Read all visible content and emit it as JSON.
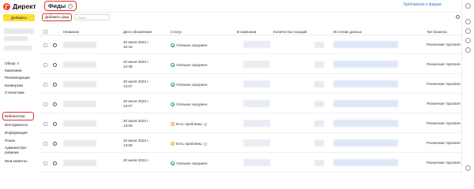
{
  "header": {
    "logo_text": "Директ",
    "page_title": "Фиды",
    "help_symbol": "?",
    "required_link": "Требования к фидам"
  },
  "sidebar": {
    "add_button": "Добавить",
    "items": [
      {
        "label": "Обзор",
        "badge": "8"
      },
      {
        "label": "Кампании",
        "badge": ""
      },
      {
        "label": "Рекомендации",
        "badge": ""
      },
      {
        "label": "Конверсии",
        "badge": ""
      },
      {
        "label": "Статистика",
        "badge": ""
      },
      {
        "label": "Библиотека",
        "badge": ""
      },
      {
        "label": "Инструменты",
        "badge": ""
      },
      {
        "label": "Информация",
        "badge": ""
      },
      {
        "label": "Поиск",
        "badge": ""
      },
      {
        "label": "Администри-",
        "badge": ""
      },
      {
        "label": "рование",
        "badge": ""
      },
      {
        "label": "Мои клиенты",
        "badge": ""
      }
    ]
  },
  "toolbar": {
    "add_feed_button": "Добавить фид",
    "search_placeholder": "Поиск"
  },
  "table": {
    "columns": [
      "Название",
      "Дата обновления",
      "Статус",
      "В кампании",
      "Количество позиций",
      "Источник данных",
      "Тип бизнеса"
    ],
    "rows": [
      {
        "date_line1": "20 июля 2023 г.",
        "date_line2": "16:15",
        "status": "Успешно загружен",
        "status_type": "ok",
        "business": "Розничная торговля"
      },
      {
        "date_line1": "20 июля 2023 г.",
        "date_line2": "14:38",
        "status": "Успешно загружен",
        "status_type": "ok",
        "business": "Розничная торговля"
      },
      {
        "date_line1": "20 июля 2023 г.",
        "date_line2": "13:07",
        "status": "Успешно загружен",
        "status_type": "ok",
        "business": "Розничная торговля"
      },
      {
        "date_line1": "20 июля 2023 г.",
        "date_line2": "13:07",
        "status": "Успешно загружен",
        "status_type": "ok",
        "business": "Розничная торговля"
      },
      {
        "date_line1": "20 июля 2023 г.",
        "date_line2": "13:06",
        "status": "Есть проблемы",
        "status_type": "warn",
        "business": "Розничная торговля"
      },
      {
        "date_line1": "20 июля 2023 г.",
        "date_line2": "13:06",
        "status": "Есть проблемы",
        "status_type": "warn",
        "business": "Розничная торговля"
      },
      {
        "date_line1": "20 июля 2023 г.",
        "date_line2": "",
        "status": "Успешно загружен",
        "status_type": "ok",
        "business": "Розничная торговля"
      }
    ]
  },
  "colors": {
    "brand_red": "#fc3f1d",
    "highlight_red": "#e0342a",
    "button_yellow": "#fddc36",
    "ok_green": "#30a14e",
    "warn_orange": "#f29c1f",
    "link_blue": "#3d78d8"
  }
}
